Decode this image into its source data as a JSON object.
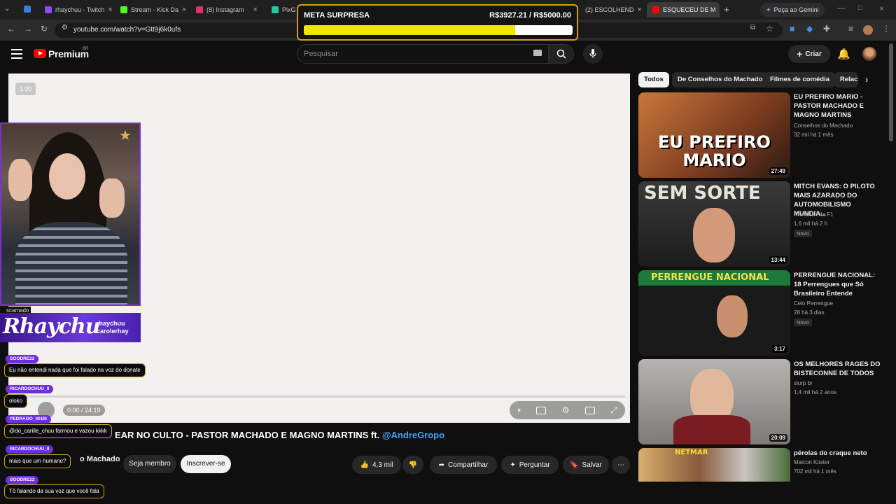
{
  "browser": {
    "tabs": [
      {
        "label": "rhaychuu - Twitch",
        "color": "#9146ff"
      },
      {
        "label": "Stream - Kick Da",
        "color": "#53fc18"
      },
      {
        "label": "(8) Instagram",
        "color": "#e1306c"
      },
      {
        "label": "PixG",
        "color": "#22c7a9"
      },
      {
        "label": "(2) ESCOLHEND",
        "color": "#ff0000"
      },
      {
        "label": "ESQUECEU DE M",
        "color": "#ff0000"
      }
    ],
    "gemini_label": "Peça ao Gemini",
    "url": "youtube.com/watch?v=Gtt9j6k0ufs"
  },
  "overlay_goal": {
    "title": "META SURPRESA",
    "value_text": "R$3927.21 / R$5000.00",
    "progress": 0.7854
  },
  "header": {
    "brand": "Premium",
    "brand_region": "BR",
    "search_placeholder": "Pesquisar",
    "create_label": "Criar"
  },
  "player": {
    "speed": "1.00",
    "time": "0:00 / 24:19"
  },
  "webcam": {
    "scene_label": "scamado",
    "streamer_name": "Rhaychu",
    "handle_1": "rhaychuu",
    "handle_2": "carolerhay"
  },
  "chat": [
    {
      "user": "SOODRE22",
      "message": "Eu não entendi nada que foi falado na voz do donate"
    },
    {
      "user": "RICARDOCHUU_II",
      "message": "oloko"
    },
    {
      "user": "PEDRAOO_001M",
      "message": "@do_carille_chuu farmou e vazou kkkk"
    },
    {
      "user": "RICARDOCHUU_II",
      "message": "mais que um humano?"
    },
    {
      "user": "SOODRE22",
      "message": "Tô falando da sua voz que você fala"
    }
  ],
  "video": {
    "title": "EAR NO CULTO - PASTOR MACHADO E MAGNO MARTINS ft.",
    "title_link": "@AndreGropo",
    "channel": "o Machado",
    "join_label": "Seja membro",
    "subscribe_label": "Inscrever-se",
    "likes": "4,3 mil",
    "share_label": "Compartilhar",
    "ask_label": "Perguntar",
    "save_label": "Salvar"
  },
  "chips": [
    "Todos",
    "De Conselhos do Machado",
    "Filmes de comédia",
    "Relac"
  ],
  "recommendations": [
    {
      "title": "EU PREFIRO MARIO - PASTOR MACHADO E MAGNO MARTINS",
      "channel": "Conselhos do Machado",
      "meta": "32 mil  há 1 mês",
      "duration": "27:49",
      "new": "",
      "thumb_text": "EU PREFIRO MARIO"
    },
    {
      "title": "MITCH EVANS: O PILOTO MAIS AZARADO DO AUTOMOBILISMO MUNDIA...",
      "channel": "Primeira Fila F1",
      "meta": "1,6 mil  há 2 h",
      "duration": "13:44",
      "new": "Novo",
      "thumb_text": "SEM SORTE"
    },
    {
      "title": "PERRENGUE NACIONAL: 18 Perrengues que Só Brasileiro Entende",
      "channel": "Celo Perrengue",
      "meta": "28  há 3 dias",
      "duration": "3:17",
      "new": "Novo",
      "thumb_text": "PERRENGUE NACIONAL"
    },
    {
      "title": "OS MELHORES RAGES DO BISTECONNE DE TODOS",
      "channel": "slurp br",
      "meta": "1,4 mil  há 2 anos",
      "duration": "20:09",
      "new": "",
      "thumb_text": ""
    },
    {
      "title": "pérolas do craque neto",
      "channel": "Maicon Küster",
      "meta": "702 mil  há 1 mês",
      "duration": "",
      "new": "",
      "thumb_text": "NETMAR"
    }
  ],
  "colors": {
    "accent_purple": "#6b2fe0",
    "goal_fill": "#f2e600",
    "yt_red": "#ff0000",
    "link_blue": "#3ea6ff"
  }
}
